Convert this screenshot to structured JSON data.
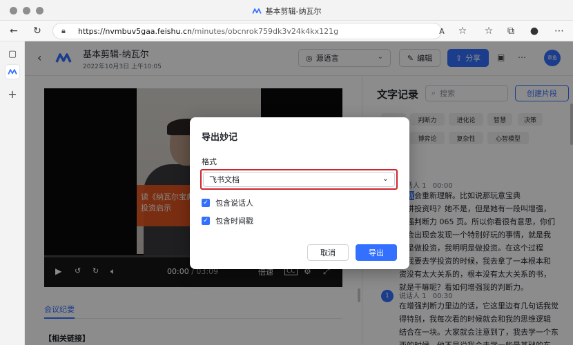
{
  "window": {
    "title": "基本剪辑-纳瓦尔"
  },
  "browser": {
    "url_host": "https://nvmbuv5gaa.feishu.cn",
    "url_path": "/minutes/obcnrok759dk3v24k4kx121g"
  },
  "header": {
    "title": "基本剪辑-纳瓦尔",
    "date": "2022年10月3日 上午10:05",
    "lang_label": "源语言",
    "edit_label": "编辑",
    "share_label": "分享",
    "avatar_text": "章鱼"
  },
  "video": {
    "overlay_line1": "读《纳瓦尔宝典",
    "overlay_line2": "投资启示",
    "current_time": "00:00",
    "separator": " / ",
    "duration": "03:09",
    "speed_label": "倍速",
    "cc_label": "CC"
  },
  "tabs": {
    "minutes": "会议纪要"
  },
  "links": {
    "title": "【相关链接】"
  },
  "transcript_panel": {
    "title": "文字记录",
    "search_placeholder": "搜索",
    "create_label": "创建片段",
    "tags": [
      "判断力",
      "进化论",
      "智慧",
      "决策",
      "博弈论",
      "复杂性",
      "心智模型"
    ],
    "speaker1": "说话人 1",
    "time1": "00:00",
    "line1a": "能",
    "line1hl": "就",
    "line1b": "会重新理解。比如说那玩意宝典",
    "line2": "实讲投资吗？她不是，但是她有一段叫增强，",
    "line3": "增强判断力 065 页。所以你看很有意思，你们",
    "line4": "能会出现会发现一个特别好玩的事情，就是我",
    "line5": "明是做投资，我明明是做投资。在这个过程",
    "line6": "，我要去学投资的时候，我去拿了一本根本和",
    "line7": "资没有太大关系的，根本没有太大关系的书，",
    "line8": "就是干嘛呢？看如何增强我的判断力。",
    "speaker2": "说话人 1",
    "time2": "00:30",
    "badge": "1",
    "p2l1": "在增强判断力里边的话，它这里边有几句话我觉",
    "p2l2": "得特别，我每次看的时候就会和我的思维逻辑",
    "p2l3": "结合在一块。大家就会注意到了，我去学一个东",
    "p2l4": "西的时候，他不是说我会去学一些最基础的东"
  },
  "dialog": {
    "title": "导出妙记",
    "format_label": "格式",
    "format_value": "飞书文档",
    "include_speaker": "包含说话人",
    "include_timestamp": "包含时间戳",
    "cancel_label": "取消",
    "ok_label": "导出"
  },
  "colors": {
    "accent": "#3370ff",
    "highlight_border": "#d0232a"
  }
}
